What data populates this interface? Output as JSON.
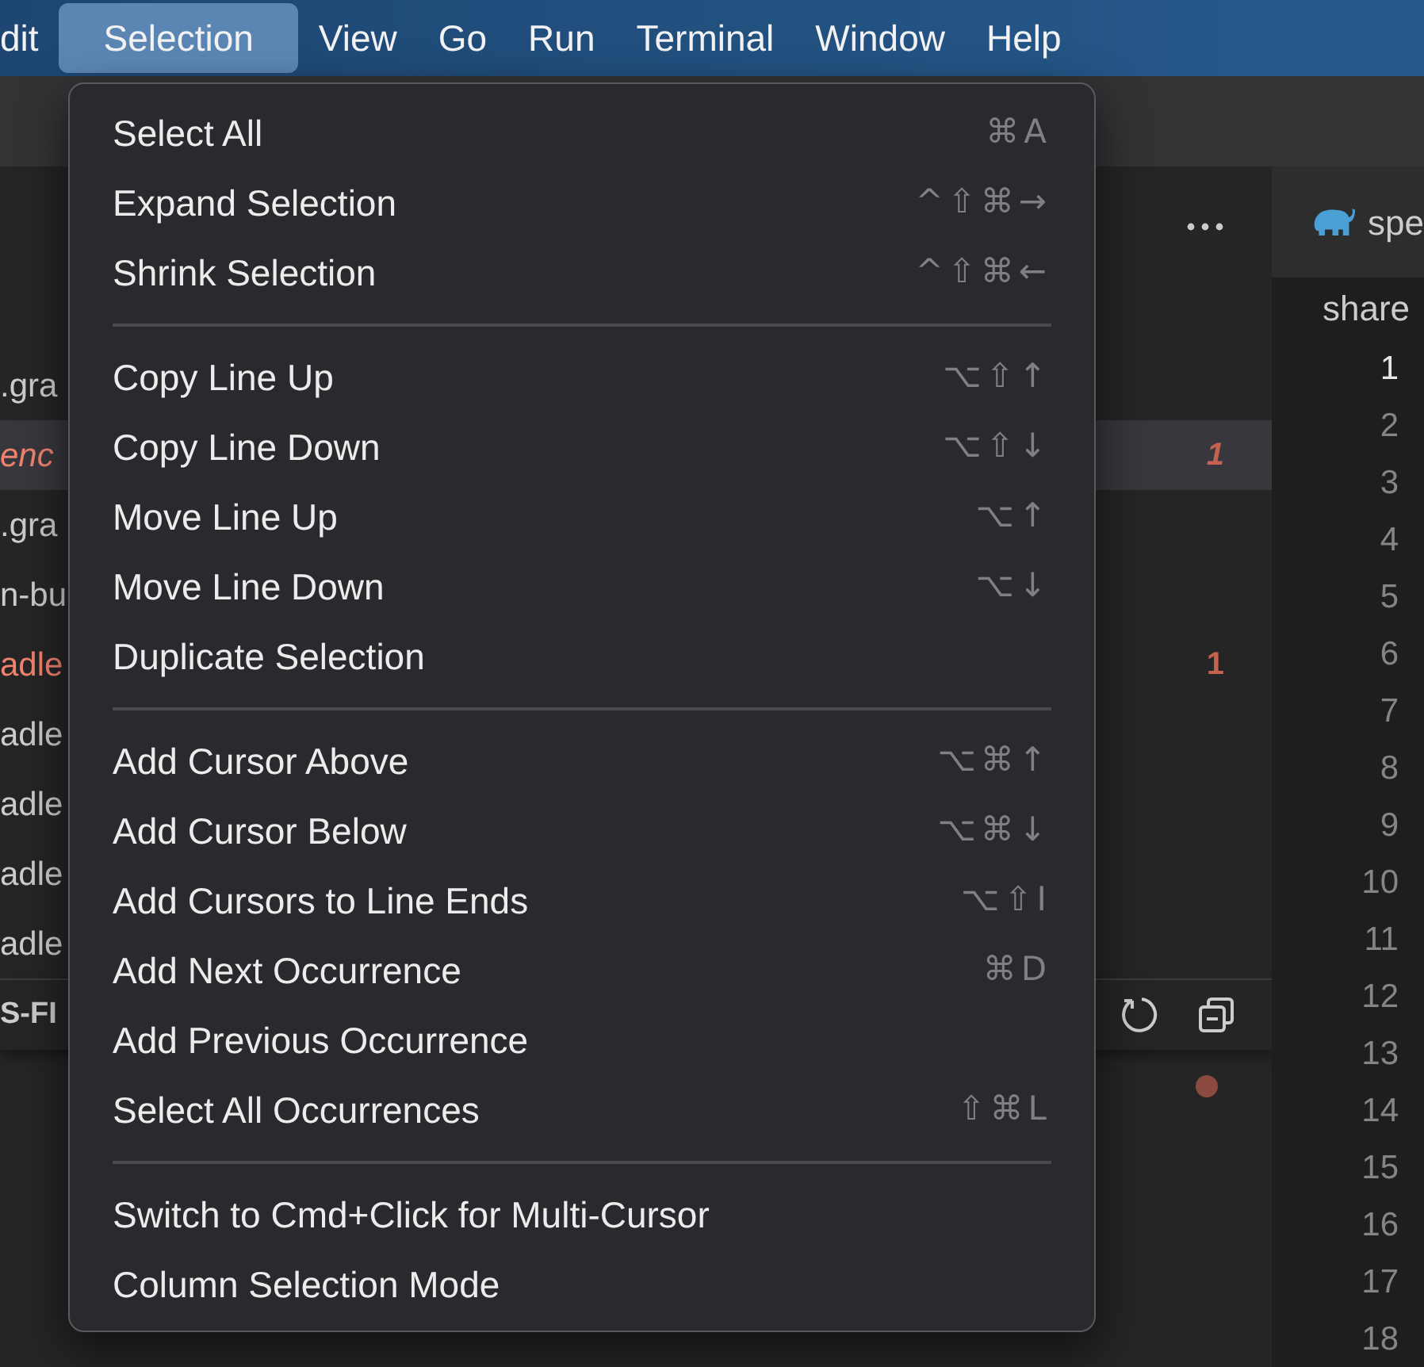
{
  "menubar": [
    {
      "label": "dit",
      "selected": false
    },
    {
      "label": "Selection",
      "selected": true
    },
    {
      "label": "View",
      "selected": false
    },
    {
      "label": "Go",
      "selected": false
    },
    {
      "label": "Run",
      "selected": false
    },
    {
      "label": "Terminal",
      "selected": false
    },
    {
      "label": "Window",
      "selected": false
    },
    {
      "label": "Help",
      "selected": false
    }
  ],
  "sidebar": {
    "rows": [
      {
        "text": ".gra",
        "error": false,
        "italic": false,
        "selected": false
      },
      {
        "text": "enc",
        "error": true,
        "italic": true,
        "selected": true,
        "badge": "1"
      },
      {
        "text": ".gra",
        "error": false,
        "italic": false,
        "selected": false
      },
      {
        "text": "n-bu",
        "error": false,
        "italic": false,
        "selected": false
      },
      {
        "text": "adle",
        "error": true,
        "italic": false,
        "selected": false,
        "badge": "1"
      },
      {
        "text": "adle",
        "error": false,
        "italic": false,
        "selected": false
      },
      {
        "text": "adle",
        "error": false,
        "italic": false,
        "selected": false
      },
      {
        "text": "adle",
        "error": false,
        "italic": false,
        "selected": false
      },
      {
        "text": "adle",
        "error": false,
        "italic": false,
        "selected": false
      }
    ],
    "section_title": "S-FI"
  },
  "editor": {
    "tab": "spe",
    "breadcrumb": "share",
    "lines": [
      {
        "number": "1",
        "current": true
      },
      {
        "number": "2",
        "current": false
      },
      {
        "number": "3",
        "current": false
      },
      {
        "number": "4",
        "current": false
      },
      {
        "number": "5",
        "current": false
      },
      {
        "number": "6",
        "current": false
      },
      {
        "number": "7",
        "current": false
      },
      {
        "number": "8",
        "current": false
      },
      {
        "number": "9",
        "current": false
      },
      {
        "number": "10",
        "current": false
      },
      {
        "number": "11",
        "current": false
      },
      {
        "number": "12",
        "current": false
      },
      {
        "number": "13",
        "current": false
      },
      {
        "number": "14",
        "current": false
      },
      {
        "number": "15",
        "current": false
      },
      {
        "number": "16",
        "current": false
      },
      {
        "number": "17",
        "current": false
      },
      {
        "number": "18",
        "current": false
      }
    ]
  },
  "menu": {
    "groups": [
      [
        {
          "label": "Select All",
          "shortcut": "⌘A"
        },
        {
          "label": "Expand Selection",
          "shortcut": "^⇧⌘→"
        },
        {
          "label": "Shrink Selection",
          "shortcut": "^⇧⌘←"
        }
      ],
      [
        {
          "label": "Copy Line Up",
          "shortcut": "⌥⇧↑"
        },
        {
          "label": "Copy Line Down",
          "shortcut": "⌥⇧↓"
        },
        {
          "label": "Move Line Up",
          "shortcut": "⌥↑"
        },
        {
          "label": "Move Line Down",
          "shortcut": "⌥↓"
        },
        {
          "label": "Duplicate Selection"
        }
      ],
      [
        {
          "label": "Add Cursor Above",
          "shortcut": "⌥⌘↑"
        },
        {
          "label": "Add Cursor Below",
          "shortcut": "⌥⌘↓"
        },
        {
          "label": "Add Cursors to Line Ends",
          "shortcut": "⌥⇧I"
        },
        {
          "label": "Add Next Occurrence",
          "shortcut": "⌘D"
        },
        {
          "label": "Add Previous Occurrence"
        },
        {
          "label": "Select All Occurrences",
          "shortcut": "⇧⌘L"
        }
      ],
      [
        {
          "label": "Switch to Cmd+Click for Multi-Cursor"
        },
        {
          "label": "Column Selection Mode"
        }
      ]
    ]
  }
}
